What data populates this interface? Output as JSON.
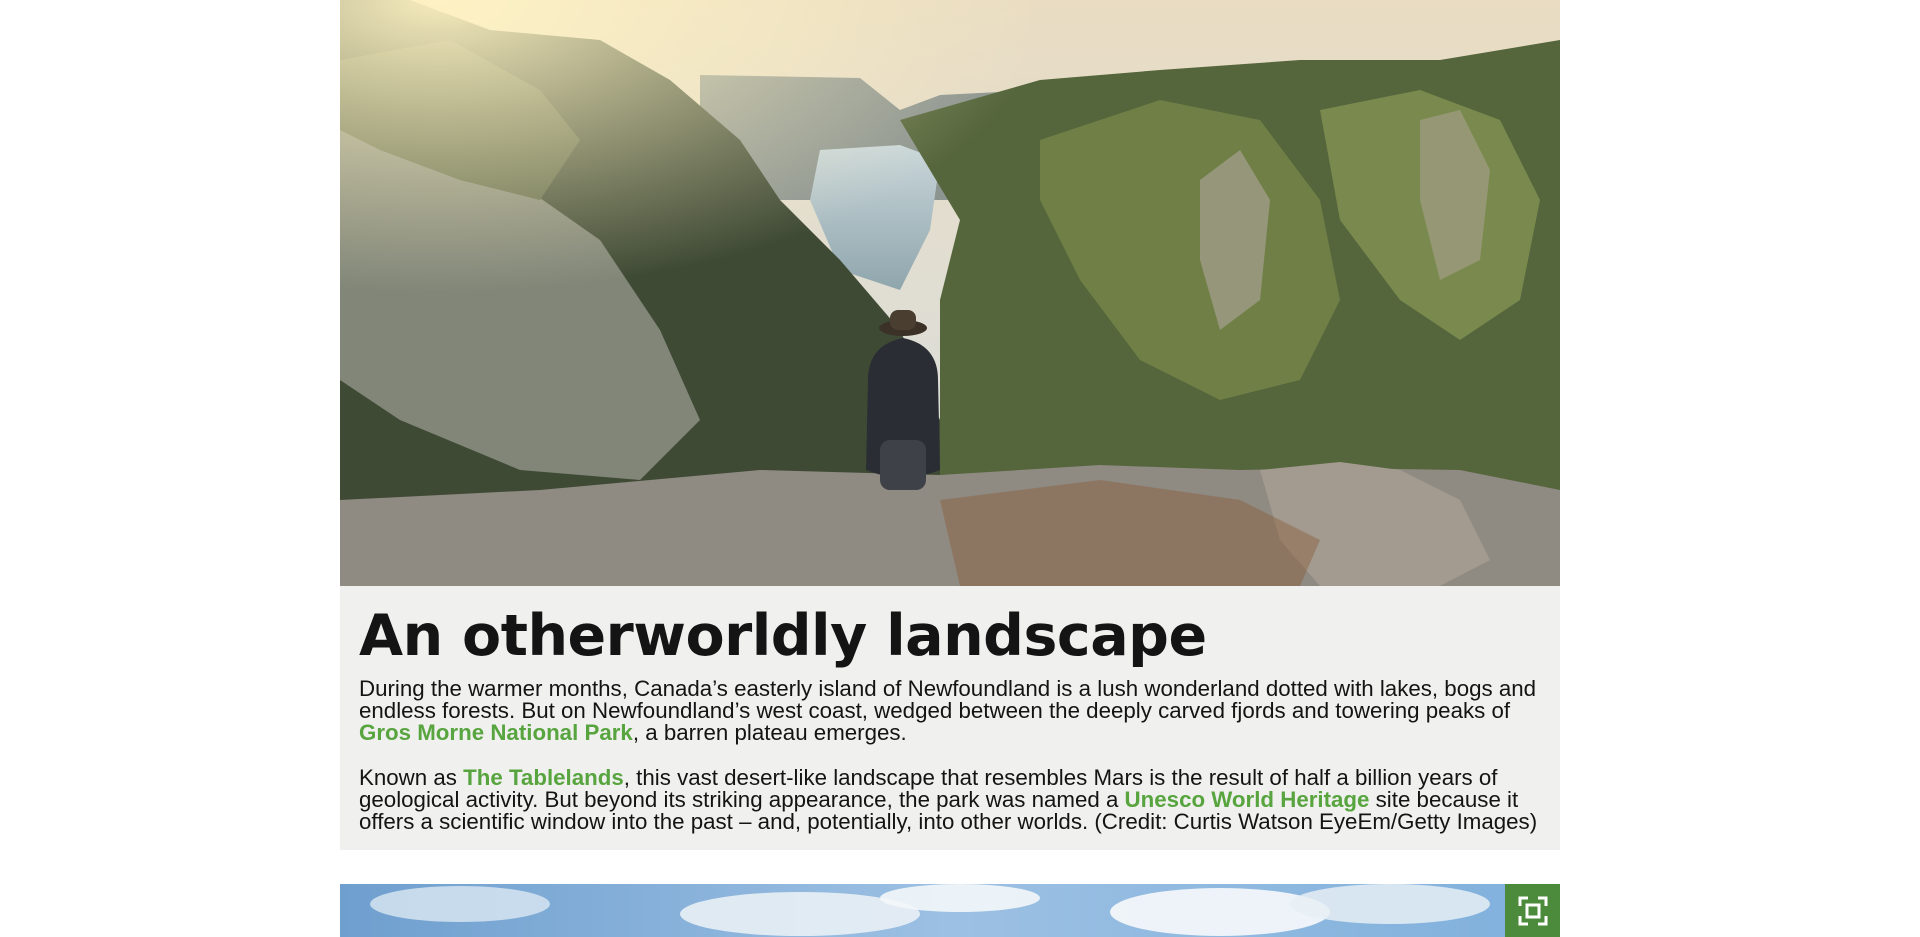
{
  "hero": {
    "image_description_icon": "landscape-photo",
    "alt": "Person seated on a rocky ledge overlooking a fjord in Gros Morne National Park"
  },
  "caption": {
    "headline": "An otherworldly landscape",
    "para1_text_a": "During the warmer months, Canada’s easterly island of Newfoundland is a lush wonderland dotted with lakes, bogs and endless forests. But on Newfoundland’s west coast, wedged between the deeply carved fjords and towering peaks of ",
    "para1_link": "Gros Morne National Park",
    "para1_text_b": ", a barren plateau emerges.",
    "para2_text_a": "Known as ",
    "para2_link1": "The Tablelands",
    "para2_text_b": ", this vast desert-like landscape that resembles Mars is the result of half a billion years of geological activity. But beyond its striking appearance, the park was named a ",
    "para2_link2": "Unesco World Heritage",
    "para2_text_c": " site because it offers a scientific window into the past – and, potentially, into other worlds. (Credit: Curtis Watson EyeEm/Getty Images)"
  },
  "next_image": {
    "expand_icon": "expand-icon"
  },
  "colors": {
    "link_green": "#58a53f",
    "button_green": "#4b8b3b",
    "caption_bg": "#f0f0ef"
  }
}
